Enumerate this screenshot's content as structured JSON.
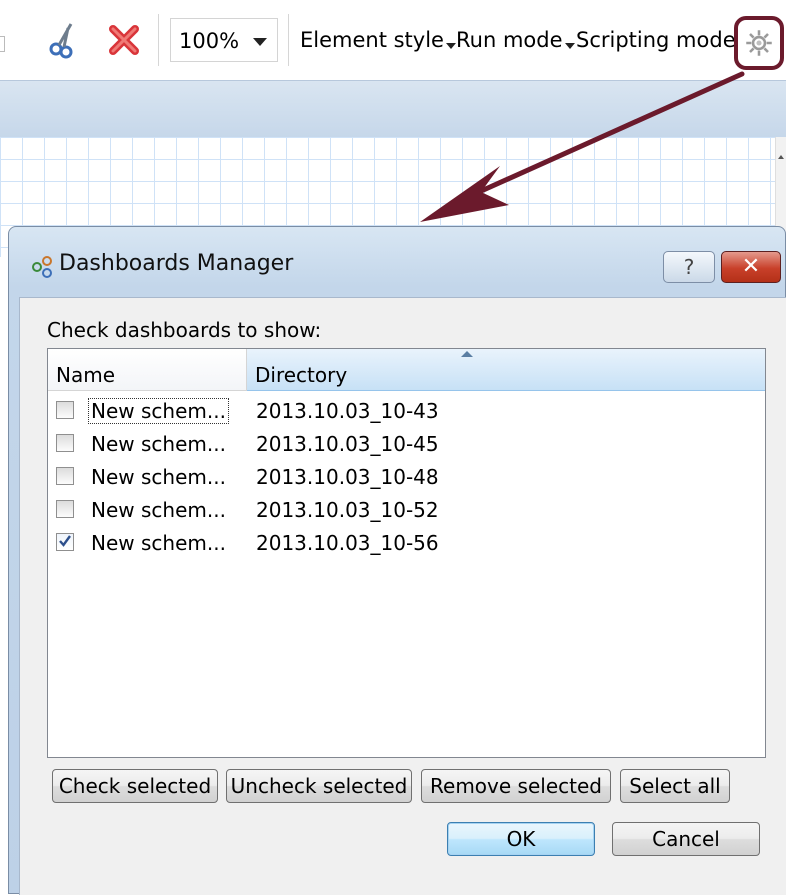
{
  "toolbar": {
    "zoom_value": "100%",
    "menus": [
      {
        "label": "Element style"
      },
      {
        "label": "Run mode"
      },
      {
        "label": "Scripting mode"
      }
    ]
  },
  "dialog": {
    "title": "Dashboards Manager",
    "help_glyph": "?",
    "close_glyph": "✕",
    "prompt": "Check dashboards to show:",
    "columns": {
      "name": "Name",
      "directory": "Directory"
    },
    "rows": [
      {
        "name": "New schem...",
        "directory": "2013.10.03_10-43",
        "checked": false
      },
      {
        "name": "New schem...",
        "directory": "2013.10.03_10-45",
        "checked": false
      },
      {
        "name": "New schem...",
        "directory": "2013.10.03_10-48",
        "checked": false
      },
      {
        "name": "New schem...",
        "directory": "2013.10.03_10-52",
        "checked": false
      },
      {
        "name": "New schem...",
        "directory": "2013.10.03_10-56",
        "checked": true
      }
    ],
    "buttons": {
      "check_selected": "Check selected",
      "uncheck_selected": "Uncheck selected",
      "remove_selected": "Remove selected",
      "select_all": "Select all",
      "ok": "OK",
      "cancel": "Cancel"
    }
  },
  "colors": {
    "annotation_arrow": "#6b1a2c",
    "title_band": "#c6d7ea",
    "close_button": "#c8402a"
  },
  "icons": [
    "cut-icon",
    "delete-icon",
    "gear-icon",
    "dashboards-icon",
    "help-icon",
    "close-icon"
  ]
}
